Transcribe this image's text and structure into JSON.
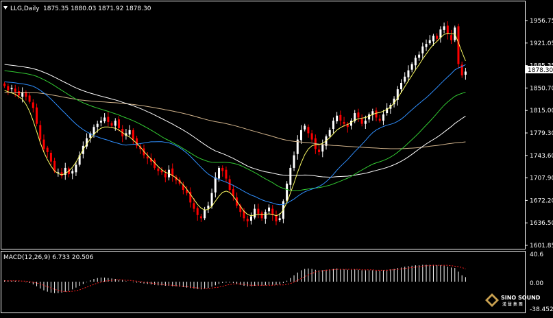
{
  "header": {
    "symbol_label": "LLG,Daily",
    "ohlc_label": "1875.35 1880.03 1871.92 1878.30"
  },
  "macd_header": {
    "label": "MACD(12,26,9) 6.733 20.506"
  },
  "price_axis": {
    "ticks": [
      "1956.75",
      "1921.05",
      "1885.35",
      "1850.70",
      "1815.00",
      "1779.30",
      "1743.60",
      "1707.90",
      "1672.20",
      "1636.50",
      "1601.85"
    ],
    "current_price_label": "1878.30"
  },
  "macd_axis": {
    "ticks": [
      "40.6",
      "0.00",
      "-38.452"
    ]
  },
  "logo": {
    "name": "SINO SOUND",
    "subtitle": "漢 聲 集 團"
  },
  "colors": {
    "background": "#000000",
    "bull_candle": "#ffffff",
    "bear_candle": "#ff0000",
    "ma_yellow": "#ffff66",
    "ma_blue": "#2f8fff",
    "ma_green": "#33cc33",
    "ma_white": "#ffffff",
    "ma_tan": "#d2b48c",
    "macd_hist": "#ffffff",
    "macd_signal": "#ff2020"
  },
  "chart_data": {
    "type": "candlestick",
    "title": "LLG,Daily",
    "ohlc_last": {
      "open": 1875.35,
      "high": 1880.03,
      "low": 1871.92,
      "close": 1878.3
    },
    "ylim": [
      1601.85,
      1970
    ],
    "close": [
      1855,
      1848,
      1852,
      1846,
      1840,
      1845,
      1838,
      1830,
      1820,
      1795,
      1770,
      1755,
      1750,
      1735,
      1720,
      1718,
      1712,
      1725,
      1715,
      1720,
      1730,
      1745,
      1760,
      1772,
      1780,
      1790,
      1795,
      1800,
      1805,
      1798,
      1792,
      1800,
      1788,
      1775,
      1780,
      1785,
      1770,
      1760,
      1755,
      1745,
      1740,
      1735,
      1725,
      1720,
      1718,
      1710,
      1722,
      1712,
      1705,
      1700,
      1690,
      1685,
      1670,
      1660,
      1650,
      1645,
      1658,
      1665,
      1685,
      1710,
      1725,
      1720,
      1708,
      1690,
      1680,
      1665,
      1655,
      1645,
      1640,
      1648,
      1660,
      1652,
      1645,
      1655,
      1662,
      1650,
      1640,
      1645,
      1672,
      1700,
      1725,
      1745,
      1770,
      1785,
      1792,
      1780,
      1770,
      1755,
      1750,
      1762,
      1775,
      1785,
      1800,
      1808,
      1800,
      1795,
      1790,
      1800,
      1812,
      1805,
      1795,
      1800,
      1810,
      1815,
      1805,
      1800,
      1810,
      1820,
      1825,
      1835,
      1850,
      1860,
      1870,
      1880,
      1890,
      1900,
      1905,
      1918,
      1922,
      1928,
      1935,
      1930,
      1945,
      1950,
      1938,
      1928,
      1948,
      1890,
      1872,
      1878
    ],
    "ma_fast": [
      1848,
      1846,
      1844,
      1842,
      1838,
      1834,
      1826,
      1815,
      1800,
      1783,
      1765,
      1750,
      1738,
      1728,
      1720,
      1716,
      1714,
      1716,
      1720,
      1726,
      1734,
      1744,
      1754,
      1763,
      1771,
      1778,
      1784,
      1788,
      1790,
      1790,
      1789,
      1788,
      1785,
      1781,
      1777,
      1774,
      1769,
      1764,
      1758,
      1751,
      1745,
      1739,
      1733,
      1727,
      1722,
      1718,
      1716,
      1713,
      1709,
      1704,
      1698,
      1691,
      1683,
      1675,
      1667,
      1661,
      1658,
      1659,
      1664,
      1672,
      1680,
      1686,
      1688,
      1686,
      1680,
      1672,
      1664,
      1656,
      1651,
      1649,
      1650,
      1651,
      1651,
      1651,
      1652,
      1651,
      1649,
      1651,
      1658,
      1670,
      1685,
      1701,
      1718,
      1733,
      1746,
      1755,
      1760,
      1762,
      1762,
      1764,
      1768,
      1773,
      1779,
      1785,
      1789,
      1792,
      1794,
      1797,
      1801,
      1803,
      1804,
      1805,
      1807,
      1810,
      1812,
      1813,
      1815,
      1818,
      1822,
      1828,
      1836,
      1845,
      1854,
      1863,
      1872,
      1881,
      1889,
      1898,
      1906,
      1914,
      1921,
      1926,
      1932,
      1937,
      1939,
      1938,
      1938,
      1924,
      1909,
      1895
    ],
    "macd_hist": [
      3,
      3,
      2,
      2,
      1,
      0,
      -1,
      -3,
      -6,
      -10,
      -15,
      -19,
      -22,
      -24,
      -25,
      -25,
      -24,
      -22,
      -20,
      -17,
      -13,
      -9,
      -5,
      -1,
      3,
      6,
      8,
      9,
      9,
      8,
      7,
      6,
      4,
      3,
      1,
      0,
      -1,
      -2,
      -3,
      -4,
      -5,
      -6,
      -7,
      -8,
      -8,
      -9,
      -9,
      -10,
      -10,
      -11,
      -12,
      -13,
      -14,
      -15,
      -16,
      -17,
      -16,
      -14,
      -11,
      -8,
      -5,
      -3,
      -2,
      -2,
      -3,
      -5,
      -7,
      -9,
      -10,
      -10,
      -9,
      -9,
      -9,
      -8,
      -7,
      -7,
      -7,
      -6,
      -3,
      2,
      8,
      14,
      20,
      25,
      28,
      29,
      28,
      26,
      25,
      25,
      26,
      27,
      28,
      29,
      28,
      27,
      26,
      26,
      27,
      26,
      25,
      25,
      25,
      25,
      24,
      24,
      25,
      26,
      27,
      28,
      30,
      31,
      33,
      34,
      35,
      36,
      36,
      37,
      37,
      37,
      37,
      36,
      36,
      35,
      33,
      31,
      30,
      22,
      14,
      10
    ],
    "macd_signal": [
      2,
      2,
      2,
      2,
      2,
      1,
      1,
      0,
      -1,
      -3,
      -5,
      -8,
      -11,
      -14,
      -17,
      -19,
      -21,
      -22,
      -22,
      -21,
      -20,
      -18,
      -15,
      -12,
      -9,
      -6,
      -3,
      -1,
      1,
      2,
      3,
      4,
      4,
      4,
      3,
      3,
      2,
      1,
      0,
      -1,
      -2,
      -3,
      -4,
      -5,
      -6,
      -7,
      -7,
      -8,
      -9,
      -9,
      -10,
      -11,
      -12,
      -13,
      -14,
      -14,
      -15,
      -15,
      -14,
      -13,
      -12,
      -10,
      -8,
      -6,
      -5,
      -5,
      -5,
      -6,
      -7,
      -8,
      -8,
      -8,
      -8,
      -8,
      -8,
      -8,
      -7,
      -7,
      -7,
      -6,
      -4,
      -1,
      3,
      7,
      11,
      15,
      18,
      21,
      23,
      24,
      25,
      26,
      26,
      27,
      27,
      27,
      27,
      27,
      27,
      27,
      26,
      26,
      26,
      26,
      25,
      25,
      25,
      25,
      26,
      26,
      27,
      28,
      29,
      30,
      31,
      32,
      33,
      34,
      35,
      35,
      36,
      36,
      36,
      36,
      36,
      35,
      34,
      33,
      31,
      28
    ]
  }
}
